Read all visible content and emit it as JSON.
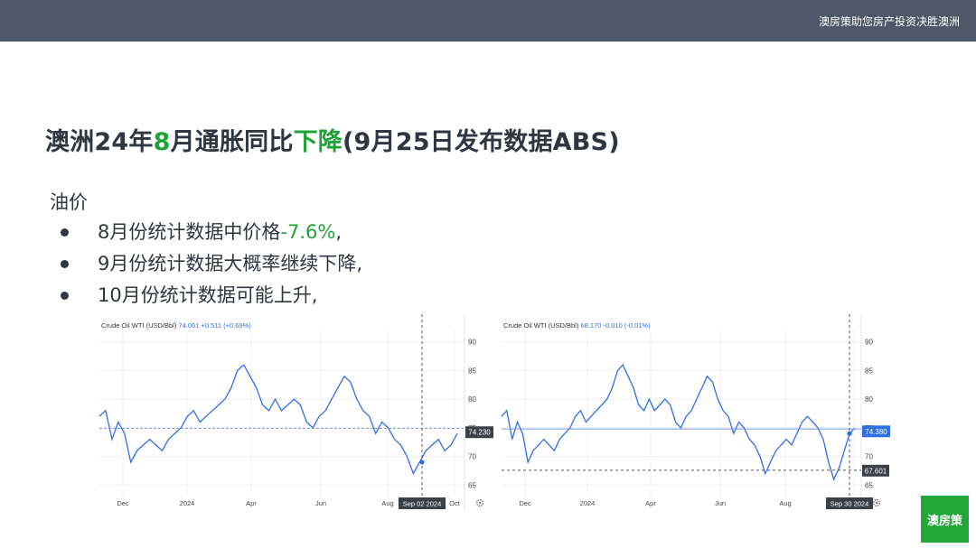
{
  "header": {
    "tagline": "澳房策助您房产投资决胜澳洲"
  },
  "title": {
    "part1": "澳洲24年",
    "highlight1": "8",
    "part2": "月通胀同比",
    "highlight2": "下降",
    "part3": "(9月25日发布数据ABS)"
  },
  "section": {
    "heading": "油价",
    "bullets": [
      {
        "text": "8月份统计数据中价格",
        "highlight": "-7.6%",
        "tail": ","
      },
      {
        "text": "9月份统计数据大概率继续下降,",
        "highlight": "",
        "tail": ""
      },
      {
        "text": "10月份统计数据可能上升,",
        "highlight": "",
        "tail": ""
      }
    ]
  },
  "logo": {
    "text": "澳房策"
  },
  "colors": {
    "accent_green": "#1fa339",
    "line_blue": "#2f6fe4",
    "topbar": "#4e5868"
  },
  "chart_data": [
    {
      "type": "line",
      "title": "Crude Oil WTI (USD/Bbl)",
      "last_value": "74.061",
      "change": "+0.511 (+0.69%)",
      "price_tag": "74.230",
      "crosshair_label": "Sep 02 2024",
      "y_ticks": [
        "90",
        "85",
        "80",
        "75",
        "70",
        "65"
      ],
      "x_ticks": [
        "Dec",
        "2024",
        "Apr",
        "Jun",
        "Aug",
        "Oct"
      ],
      "ylim": [
        63,
        92
      ],
      "settings_icon": "gear-icon",
      "series": [
        {
          "values": [
            77,
            78,
            73,
            76,
            74,
            69,
            71,
            72,
            73,
            72,
            71,
            73,
            74,
            75,
            77,
            78,
            76,
            77,
            78,
            79,
            80,
            82,
            85,
            86,
            84,
            82,
            79,
            78,
            80,
            78,
            79,
            80,
            79,
            76,
            75,
            77,
            78,
            80,
            82,
            84,
            83,
            80,
            78,
            77,
            74,
            76,
            75,
            73,
            72,
            70,
            67,
            69,
            71,
            72,
            73,
            71,
            72,
            74
          ]
        }
      ]
    },
    {
      "type": "line",
      "title": "Crude Oil WTI (USD/Bbl)",
      "last_value": "68.170",
      "change": "-0.010 (-0.01%)",
      "price_tag": "74.380",
      "cursor_tag": "67.601",
      "crosshair_label": "Sep 30 2024",
      "y_ticks": [
        "90",
        "85",
        "80",
        "75",
        "70",
        "65"
      ],
      "x_ticks": [
        "Dec",
        "2024",
        "Apr",
        "Jun",
        "Aug",
        "Oct"
      ],
      "ylim": [
        63,
        92
      ],
      "settings_icon": "gear-icon",
      "series": [
        {
          "values": [
            77,
            78,
            73,
            76,
            74,
            69,
            71,
            72,
            73,
            72,
            71,
            73,
            74,
            75,
            77,
            78,
            76,
            77,
            78,
            79,
            80,
            82,
            85,
            86,
            84,
            82,
            79,
            78,
            80,
            78,
            79,
            80,
            79,
            76,
            75,
            77,
            78,
            80,
            82,
            84,
            83,
            80,
            78,
            77,
            74,
            76,
            75,
            73,
            72,
            70,
            67,
            69,
            71,
            72,
            73,
            72,
            74,
            76,
            77,
            76,
            75,
            73,
            69,
            66,
            68,
            71,
            74,
            75
          ]
        }
      ]
    }
  ]
}
